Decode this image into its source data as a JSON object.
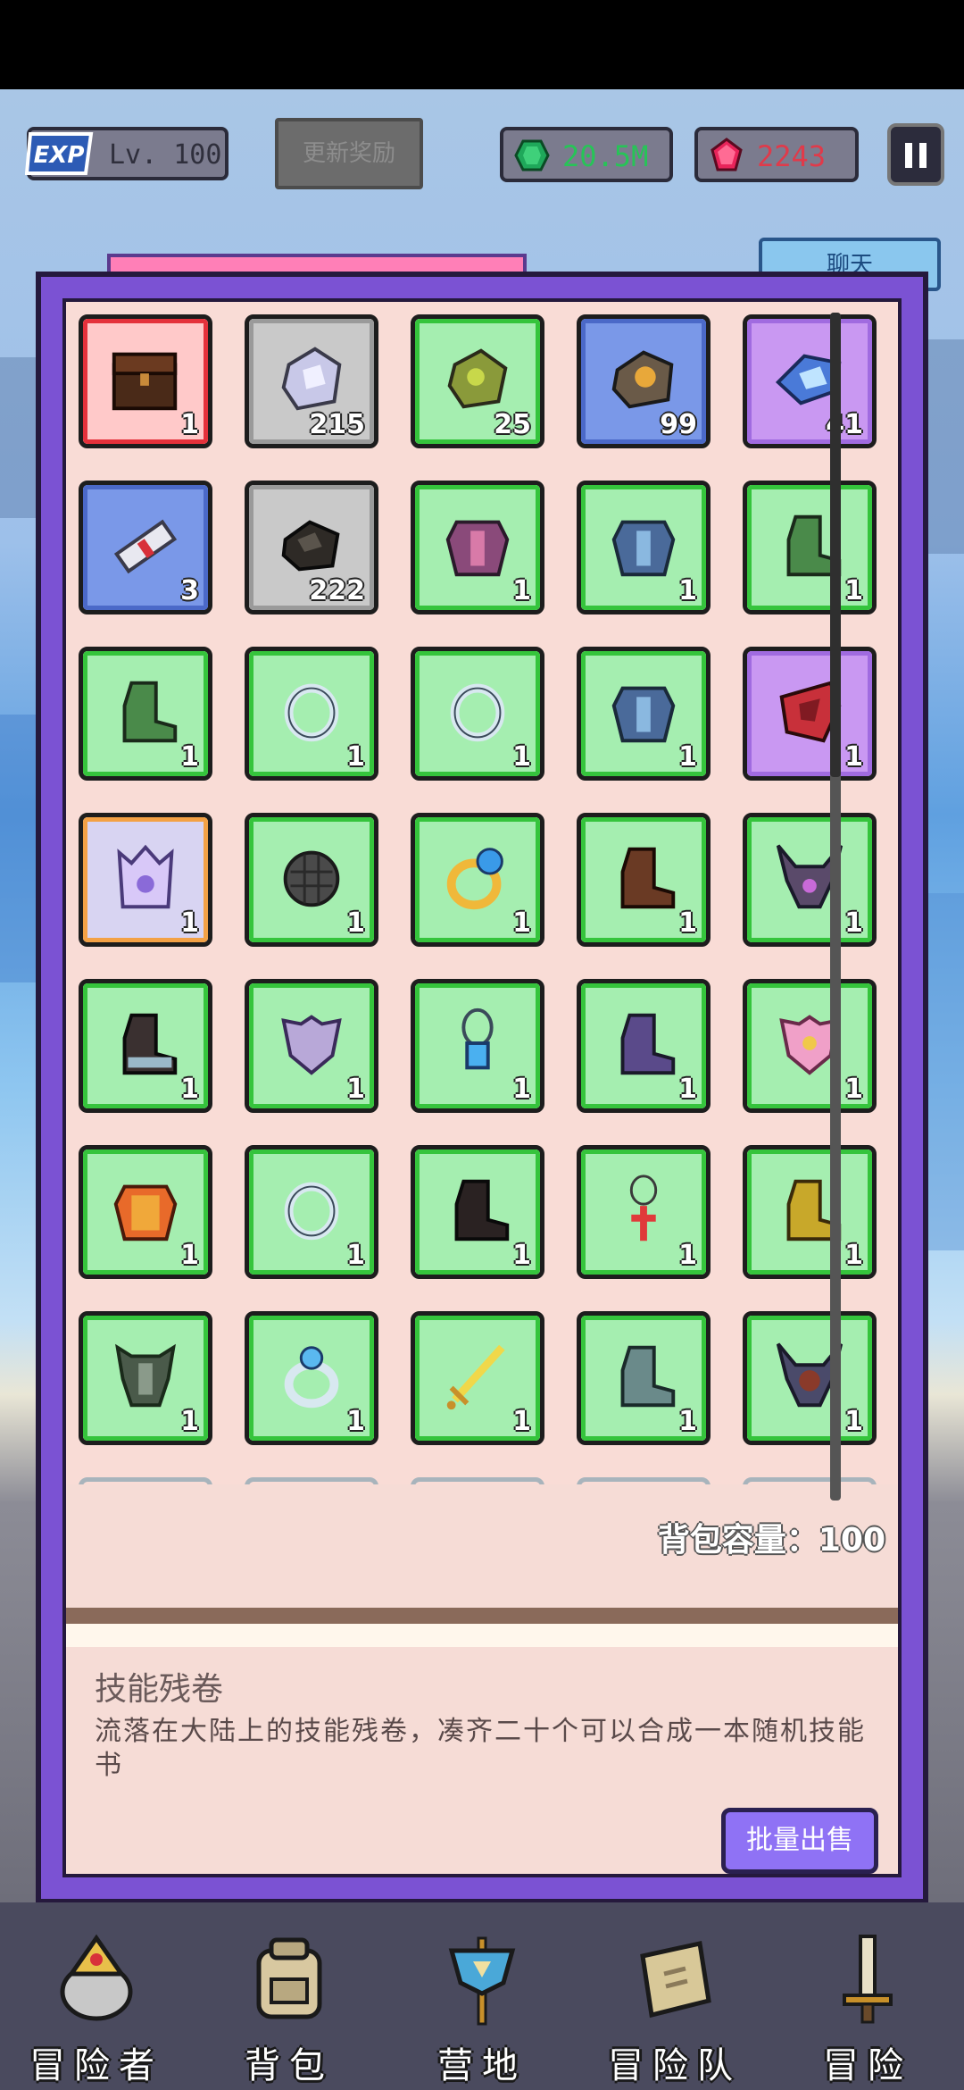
{
  "header": {
    "exp_badge": "EXP",
    "level": "Lv. 100",
    "update_reward": "更新奖励",
    "green_currency": "20.5M",
    "red_currency": "2243",
    "chat_tab": "聊天"
  },
  "colors": {
    "panel": "#7b52d3",
    "panel_bg": "#f6dcd6",
    "slot_green": "#a5eeb0",
    "slot_gray": "#c9c9c9",
    "slot_blue": "#7a98e8",
    "slot_purple": "#c998f2",
    "slot_red": "#ffc9c9",
    "slot_orange": "#f3a145",
    "sell_button": "#8f72f5"
  },
  "inventory": {
    "items": [
      {
        "count": "1",
        "rarity": "red",
        "icon": "treasure-chest-icon"
      },
      {
        "count": "215",
        "rarity": "gray",
        "icon": "silver-ore-icon"
      },
      {
        "count": "25",
        "rarity": "green",
        "icon": "green-ore-icon"
      },
      {
        "count": "99",
        "rarity": "blue",
        "icon": "gold-ore-icon"
      },
      {
        "count": "41",
        "rarity": "purple",
        "icon": "crystal-ore-icon"
      },
      {
        "count": "3",
        "rarity": "blue",
        "icon": "skill-scroll-icon"
      },
      {
        "count": "222",
        "rarity": "gray",
        "icon": "coal-ore-icon"
      },
      {
        "count": "1",
        "rarity": "green",
        "icon": "purple-armor-icon"
      },
      {
        "count": "1",
        "rarity": "green",
        "icon": "blue-armor-icon"
      },
      {
        "count": "1",
        "rarity": "green",
        "icon": "green-boots-icon"
      },
      {
        "count": "1",
        "rarity": "green",
        "icon": "green-boots-icon"
      },
      {
        "count": "1",
        "rarity": "green",
        "icon": "silver-ring-icon"
      },
      {
        "count": "1",
        "rarity": "green",
        "icon": "silver-ring-icon"
      },
      {
        "count": "1",
        "rarity": "green",
        "icon": "blue-armor-icon"
      },
      {
        "count": "1",
        "rarity": "purple",
        "icon": "red-shield-icon"
      },
      {
        "count": "1",
        "rarity": "orange",
        "icon": "crown-armor-icon"
      },
      {
        "count": "1",
        "rarity": "green",
        "icon": "dark-orb-icon"
      },
      {
        "count": "1",
        "rarity": "green",
        "icon": "gold-ring-icon"
      },
      {
        "count": "1",
        "rarity": "green",
        "icon": "brown-boots-icon"
      },
      {
        "count": "1",
        "rarity": "green",
        "icon": "horned-armor-icon"
      },
      {
        "count": "1",
        "rarity": "green",
        "icon": "dark-boots-icon"
      },
      {
        "count": "1",
        "rarity": "green",
        "icon": "silver-chestplate-icon"
      },
      {
        "count": "1",
        "rarity": "green",
        "icon": "sapphire-necklace-icon"
      },
      {
        "count": "1",
        "rarity": "green",
        "icon": "purple-boots-icon"
      },
      {
        "count": "1",
        "rarity": "green",
        "icon": "pink-chestplate-icon"
      },
      {
        "count": "1",
        "rarity": "green",
        "icon": "fire-armor-icon"
      },
      {
        "count": "1",
        "rarity": "green",
        "icon": "silver-ring-icon"
      },
      {
        "count": "1",
        "rarity": "green",
        "icon": "black-boots-icon"
      },
      {
        "count": "1",
        "rarity": "green",
        "icon": "cross-necklace-icon"
      },
      {
        "count": "1",
        "rarity": "green",
        "icon": "gold-boots-icon"
      },
      {
        "count": "1",
        "rarity": "green",
        "icon": "green-armor-icon"
      },
      {
        "count": "1",
        "rarity": "green",
        "icon": "diamond-ring-icon"
      },
      {
        "count": "1",
        "rarity": "green",
        "icon": "golden-sword-icon"
      },
      {
        "count": "1",
        "rarity": "green",
        "icon": "steel-boots-icon"
      },
      {
        "count": "1",
        "rarity": "green",
        "icon": "dark-horned-armor-icon"
      }
    ],
    "capacity": "背包容量：100"
  },
  "detail": {
    "title": "技能残卷",
    "description": "流落在大陆上的技能残卷，凑齐二十个可以合成一本随机技能书",
    "sell_button": "批量出售"
  },
  "nav": [
    {
      "label": "冒险者",
      "icon": "adventurer-helmet-icon"
    },
    {
      "label": "背包",
      "icon": "backpack-icon"
    },
    {
      "label": "营地",
      "icon": "camp-banner-icon"
    },
    {
      "label": "冒险队",
      "icon": "team-book-icon"
    },
    {
      "label": "冒险",
      "icon": "sword-icon"
    }
  ]
}
